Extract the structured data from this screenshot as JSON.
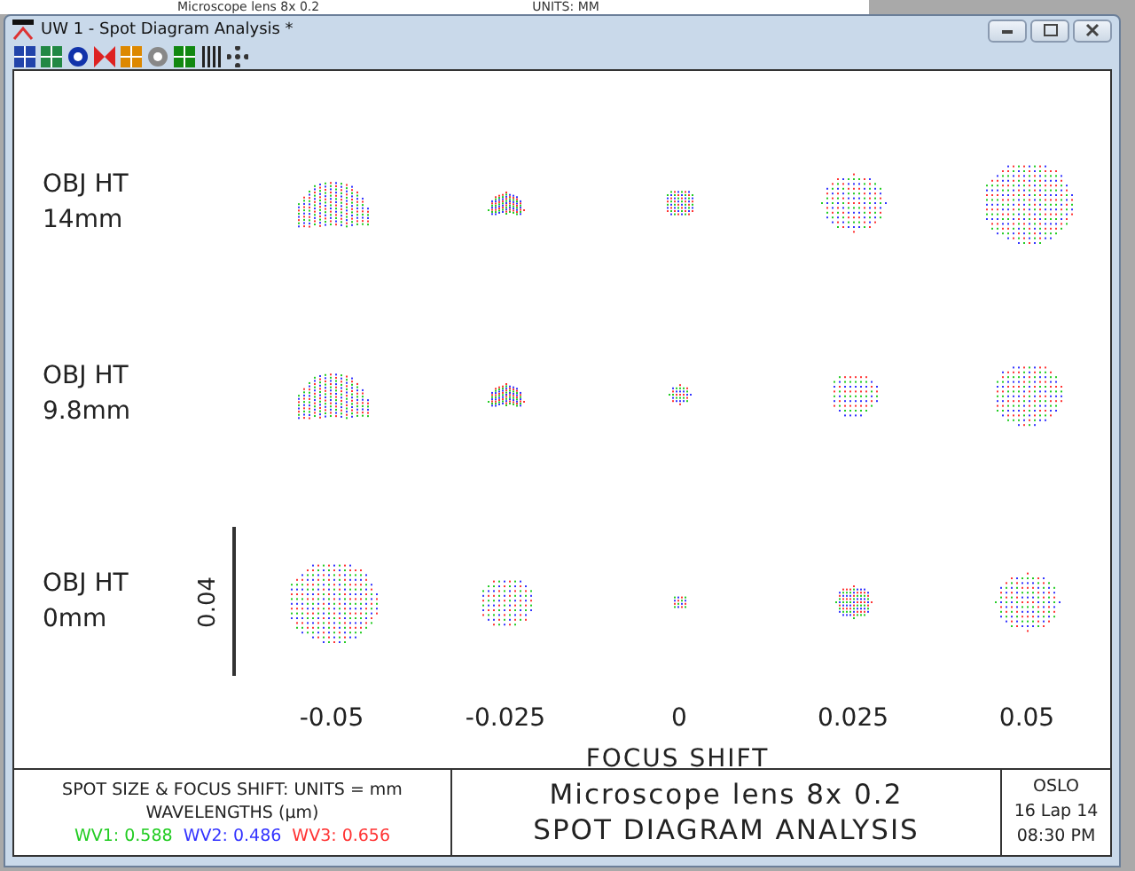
{
  "background_window": {
    "title": "Microscope lens 8x 0.2",
    "units": "UNITS: MM"
  },
  "window": {
    "title": "UW 1 - Spot Diagram Analysis *"
  },
  "plot": {
    "rows": [
      {
        "label_line_1": "OBJ HT",
        "label_line_2": "14mm"
      },
      {
        "label_line_1": "OBJ HT",
        "label_line_2": "9.8mm"
      },
      {
        "label_line_1": "OBJ HT",
        "label_line_2": "0mm"
      }
    ],
    "scale_label": "0.04",
    "columns": [
      "-0.05",
      "-0.025",
      "0",
      "0.025",
      "0.05"
    ],
    "x_axis_title": "FOCUS SHIFT"
  },
  "footer": {
    "units": "SPOT SIZE & FOCUS SHIFT: UNITS = mm",
    "wavelengths_title": "WAVELENGTHS (μm)",
    "wavelengths": [
      {
        "label": "WV1: 0.588",
        "color": "#22cc22"
      },
      {
        "label": "WV2: 0.486",
        "color": "#3333ff"
      },
      {
        "label": "WV3: 0.656",
        "color": "#ff3333"
      }
    ],
    "lens_title": "Microscope lens 8x 0.2",
    "analysis_title": "SPOT DIAGRAM ANALYSIS",
    "program": "OSLO",
    "date": "16 Lap 14",
    "time": "08:30 PM"
  }
}
